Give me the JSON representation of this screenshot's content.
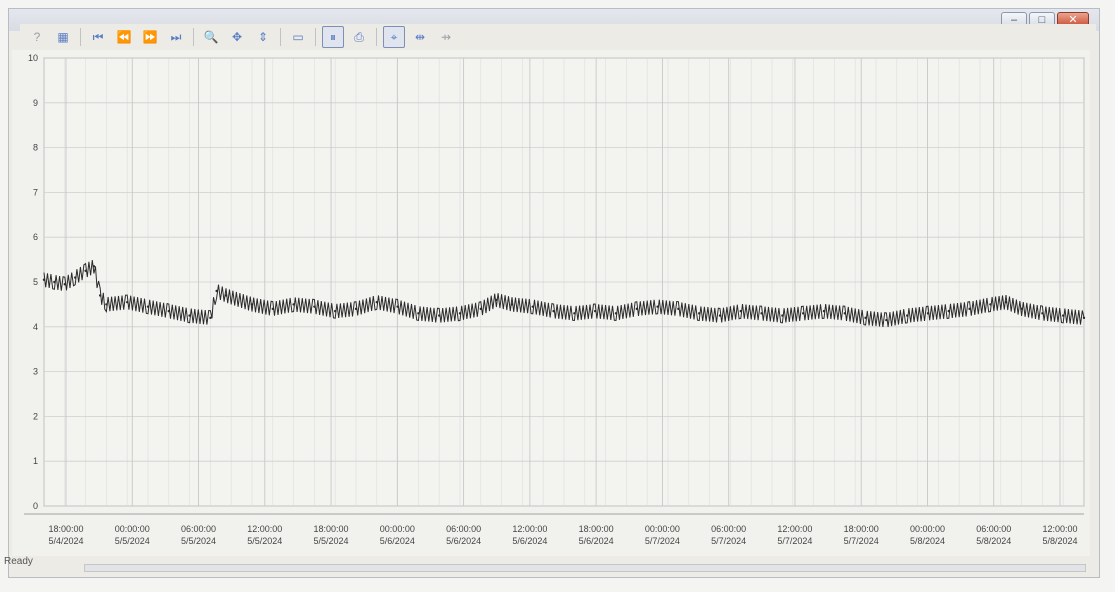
{
  "window": {
    "buttons": {
      "minimize": "–",
      "maximize": "□",
      "close": "✕"
    }
  },
  "toolbar": {
    "buttons": [
      {
        "icon": "help-icon",
        "glyph": "?"
      },
      {
        "icon": "properties-icon",
        "glyph": "▦"
      },
      {
        "icon": "first-icon",
        "glyph": "⏮"
      },
      {
        "icon": "rewind-icon",
        "glyph": "⏪"
      },
      {
        "icon": "fast-forward-icon",
        "glyph": "⏩"
      },
      {
        "icon": "last-icon",
        "glyph": "⏭"
      },
      {
        "icon": "zoom-icon",
        "glyph": "🔍"
      },
      {
        "icon": "pan-icon",
        "glyph": "✥"
      },
      {
        "icon": "scale-icon",
        "glyph": "⇕"
      },
      {
        "icon": "window-icon",
        "glyph": "▭"
      },
      {
        "icon": "pause-icon",
        "glyph": "⏸"
      },
      {
        "icon": "print-icon",
        "glyph": "⎙"
      },
      {
        "icon": "cursor-icon",
        "glyph": "⌖"
      },
      {
        "icon": "range-icon",
        "glyph": "⇹"
      },
      {
        "icon": "range-disabled-icon",
        "glyph": "⇸"
      }
    ]
  },
  "status": {
    "text": "Ready"
  },
  "chart_data": {
    "type": "line",
    "ylim": [
      0,
      10
    ],
    "yticks": [
      0,
      1,
      2,
      3,
      4,
      5,
      6,
      7,
      8,
      9,
      10
    ],
    "xlim_hours": [
      0,
      100
    ],
    "x_ticks": [
      {
        "time": "18:00:00",
        "date": "5/4/2024"
      },
      {
        "time": "00:00:00",
        "date": "5/5/2024"
      },
      {
        "time": "06:00:00",
        "date": "5/5/2024"
      },
      {
        "time": "12:00:00",
        "date": "5/5/2024"
      },
      {
        "time": "18:00:00",
        "date": "5/5/2024"
      },
      {
        "time": "00:00:00",
        "date": "5/6/2024"
      },
      {
        "time": "06:00:00",
        "date": "5/6/2024"
      },
      {
        "time": "12:00:00",
        "date": "5/6/2024"
      },
      {
        "time": "18:00:00",
        "date": "5/6/2024"
      },
      {
        "time": "00:00:00",
        "date": "5/7/2024"
      },
      {
        "time": "06:00:00",
        "date": "5/7/2024"
      },
      {
        "time": "12:00:00",
        "date": "5/7/2024"
      },
      {
        "time": "18:00:00",
        "date": "5/7/2024"
      },
      {
        "time": "00:00:00",
        "date": "5/8/2024"
      },
      {
        "time": "06:00:00",
        "date": "5/8/2024"
      },
      {
        "time": "12:00:00",
        "date": "5/8/2024"
      }
    ],
    "series": [
      {
        "color": "#2b2b2b",
        "points": [
          [
            0,
            5.05
          ],
          [
            1,
            5.0
          ],
          [
            2,
            4.95
          ],
          [
            3,
            5.1
          ],
          [
            4,
            5.25
          ],
          [
            4.8,
            5.35
          ],
          [
            5.4,
            4.7
          ],
          [
            6,
            4.5
          ],
          [
            8,
            4.55
          ],
          [
            10,
            4.45
          ],
          [
            12,
            4.35
          ],
          [
            14,
            4.25
          ],
          [
            16,
            4.2
          ],
          [
            16.6,
            4.8
          ],
          [
            17.5,
            4.7
          ],
          [
            20,
            4.5
          ],
          [
            22,
            4.4
          ],
          [
            24,
            4.5
          ],
          [
            26,
            4.45
          ],
          [
            28,
            4.35
          ],
          [
            30,
            4.4
          ],
          [
            32,
            4.55
          ],
          [
            34,
            4.45
          ],
          [
            36,
            4.3
          ],
          [
            38,
            4.25
          ],
          [
            40,
            4.3
          ],
          [
            42,
            4.4
          ],
          [
            43.5,
            4.6
          ],
          [
            45,
            4.5
          ],
          [
            47,
            4.45
          ],
          [
            49,
            4.35
          ],
          [
            51,
            4.3
          ],
          [
            53,
            4.35
          ],
          [
            55,
            4.3
          ],
          [
            57,
            4.4
          ],
          [
            59,
            4.45
          ],
          [
            61,
            4.4
          ],
          [
            63,
            4.3
          ],
          [
            65,
            4.25
          ],
          [
            67,
            4.35
          ],
          [
            69,
            4.3
          ],
          [
            71,
            4.25
          ],
          [
            73,
            4.3
          ],
          [
            75,
            4.35
          ],
          [
            77,
            4.3
          ],
          [
            79,
            4.2
          ],
          [
            81,
            4.15
          ],
          [
            83,
            4.25
          ],
          [
            85,
            4.3
          ],
          [
            87,
            4.35
          ],
          [
            89,
            4.4
          ],
          [
            91,
            4.5
          ],
          [
            92.5,
            4.55
          ],
          [
            94,
            4.4
          ],
          [
            96,
            4.3
          ],
          [
            98,
            4.25
          ],
          [
            100,
            4.2
          ]
        ]
      }
    ]
  }
}
